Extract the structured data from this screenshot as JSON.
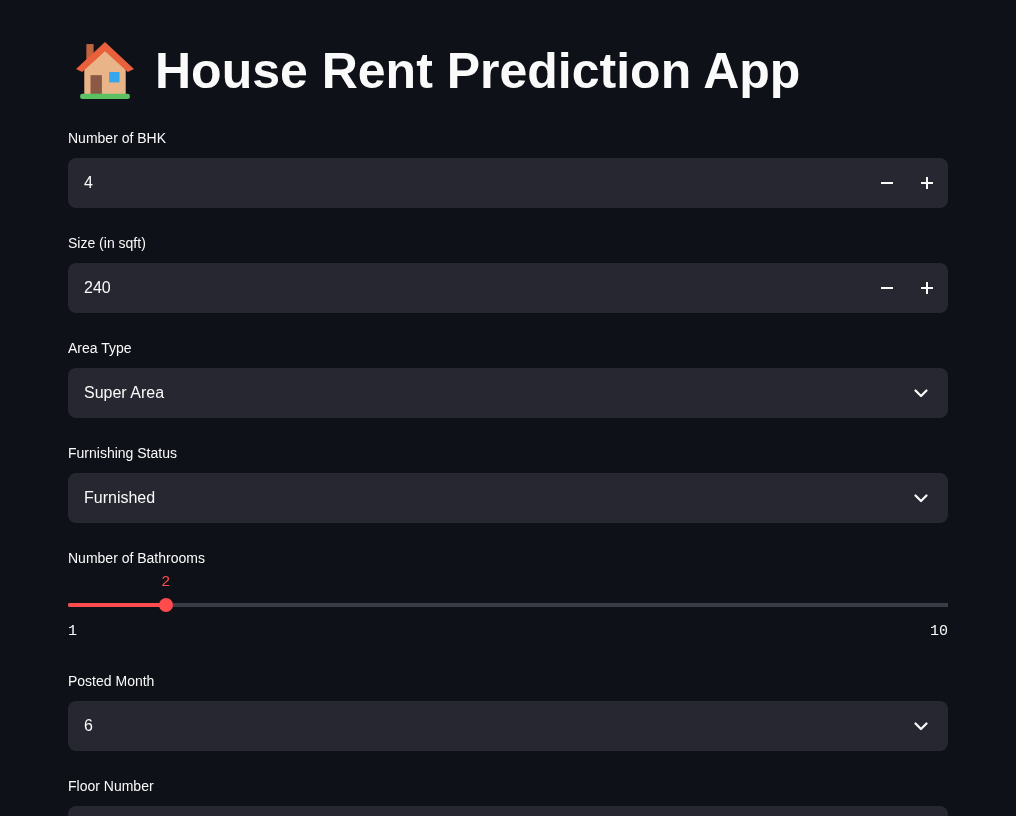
{
  "title": "House Rent Prediction App",
  "inputs": [
    {
      "kind": "number",
      "label": "Number of BHK",
      "value": "4"
    },
    {
      "kind": "number",
      "label": "Size (in sqft)",
      "value": "240"
    },
    {
      "kind": "select",
      "label": "Area Type",
      "value": "Super Area"
    },
    {
      "kind": "select",
      "label": "Furnishing Status",
      "value": "Furnished"
    },
    {
      "kind": "slider",
      "label": "Number of Bathrooms",
      "value": "2",
      "min": "1",
      "max": "10",
      "level": 0.111
    },
    {
      "kind": "select",
      "label": "Posted Month",
      "value": "6"
    },
    {
      "kind": "field",
      "label": "Floor Number"
    }
  ]
}
